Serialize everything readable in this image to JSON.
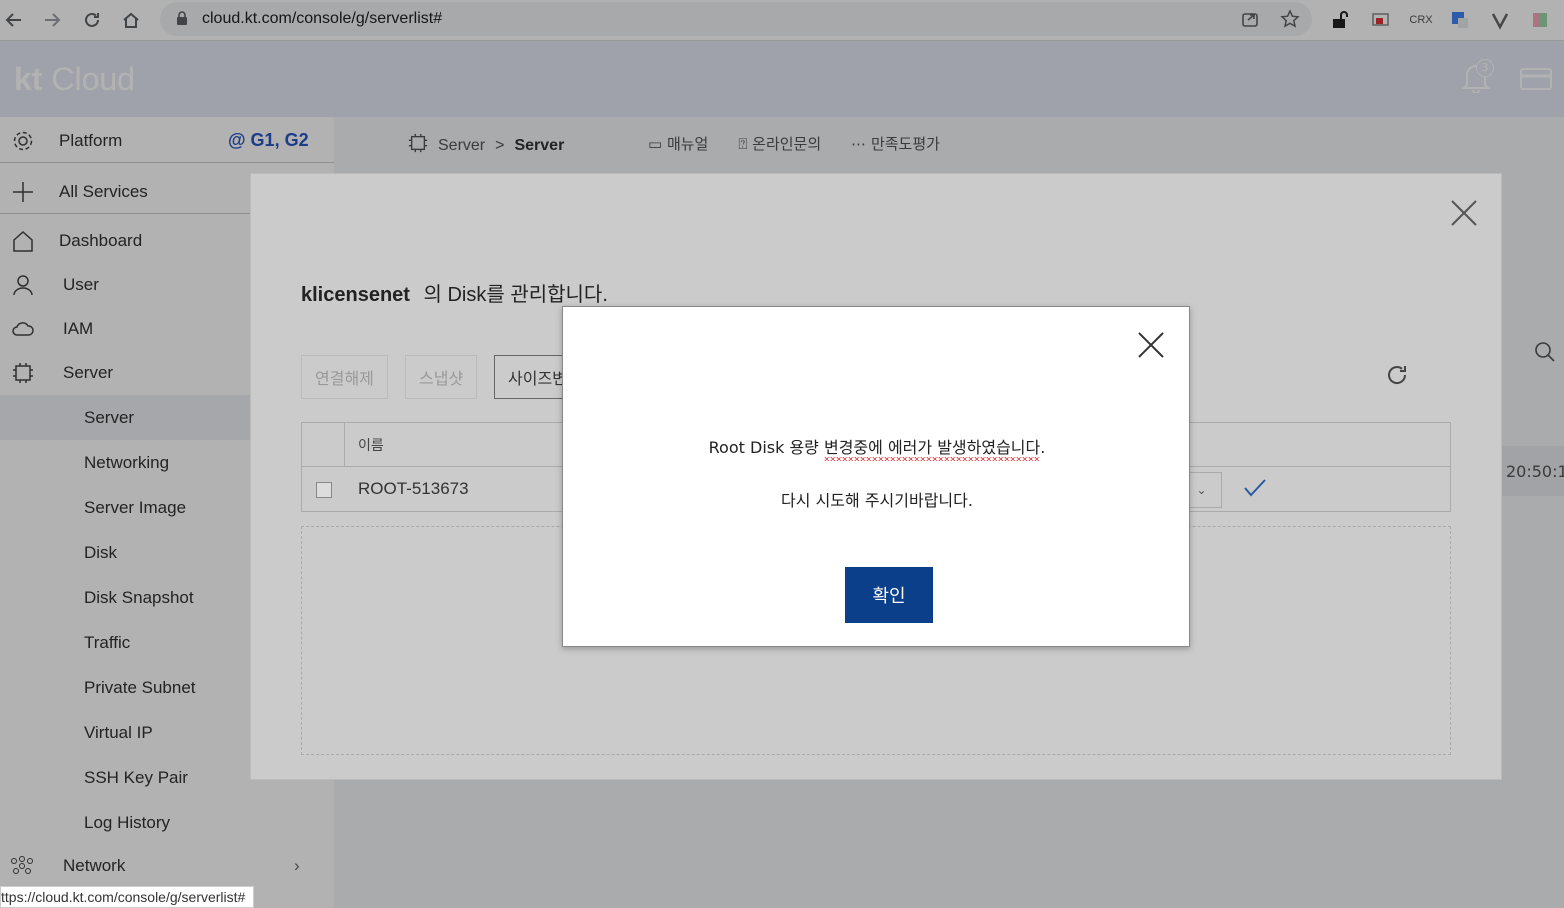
{
  "browser": {
    "url": "cloud.kt.com/console/g/serverlist#",
    "status_url": "ttps://cloud.kt.com/console/g/serverlist#",
    "ext_crx_label": "CRX"
  },
  "header": {
    "logo_kt": "kt",
    "logo_cloud": "Cloud",
    "notification_count": "3"
  },
  "sidebar": {
    "platform_label": "Platform",
    "platform_value": "@ G1, G2",
    "all_services": "All Services",
    "items": [
      {
        "label": "Dashboard"
      },
      {
        "label": "User"
      },
      {
        "label": "IAM"
      },
      {
        "label": "Server"
      }
    ],
    "sub_items": [
      {
        "label": "Server"
      },
      {
        "label": "Networking"
      },
      {
        "label": "Server Image"
      },
      {
        "label": "Disk"
      },
      {
        "label": "Disk Snapshot"
      },
      {
        "label": "Traffic"
      },
      {
        "label": "Private Subnet"
      },
      {
        "label": "Virtual IP"
      },
      {
        "label": "SSH Key Pair"
      },
      {
        "label": "Log History"
      }
    ],
    "network_label": "Network"
  },
  "breadcrumb": {
    "first": "Server",
    "sep": ">",
    "second": "Server"
  },
  "toplinks": {
    "manual": "매뉴얼",
    "inquiry": "온라인문의",
    "survey": "만족도평가"
  },
  "background": {
    "time_fragment": "20:50:1"
  },
  "disk_modal": {
    "server_name": "klicensenet",
    "title_suffix": "의 Disk를 관리합니다.",
    "buttons": {
      "disconnect": "연결해제",
      "snapshot": "스냅샷",
      "resize": "사이즈변"
    },
    "table": {
      "header_name": "이름",
      "row_name": "ROOT-513673"
    }
  },
  "alert": {
    "message_part1": "Root Disk 용량 ",
    "message_part2": "변경중에 에러가 발생하였습니다",
    "message_part3": ".",
    "message_line2": "다시 시도해 주시기바랍니다.",
    "confirm_label": "확인"
  }
}
